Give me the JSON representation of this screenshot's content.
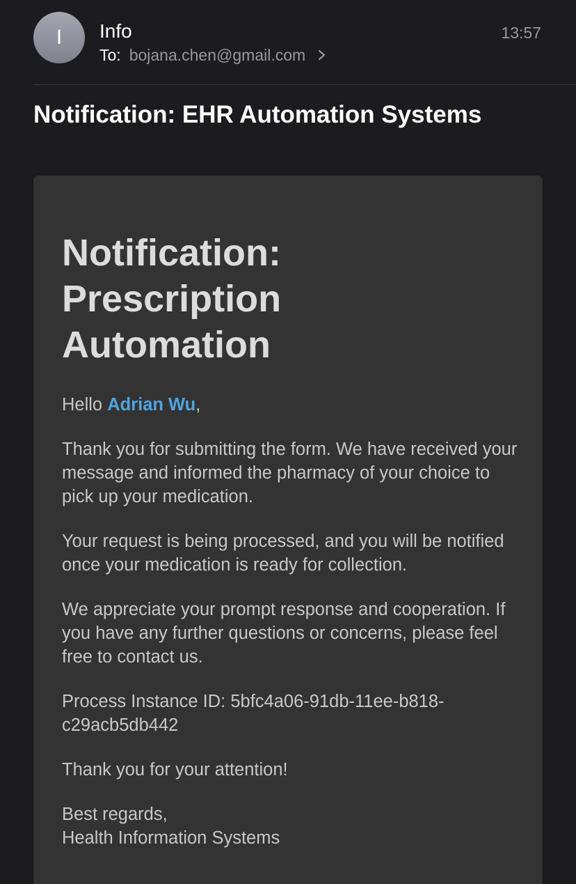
{
  "header": {
    "avatar_initial": "I",
    "sender": "Info",
    "to_label": "To:",
    "to_address": "bojana.chen@gmail.com",
    "time": "13:57"
  },
  "subject": "Notification: EHR Automation Systems",
  "email": {
    "title_line1": "Notification:",
    "title_line2": "Prescription",
    "title_line3": "Automation",
    "greeting_prefix": "Hello ",
    "recipient_name": "Adrian Wu",
    "greeting_suffix": ",",
    "paragraph1": "Thank you for submitting the form. We have received your message and informed the pharmacy of your choice to pick up your medication.",
    "paragraph2": "Your request is being processed, and you will be notified once your medication is ready for collection.",
    "paragraph3": "We appreciate your prompt response and cooperation. If you have any further questions or concerns, please feel free to contact us.",
    "process_line1": "Process Instance ID: 5bfc4a06-91db-11ee-b818-",
    "process_line2": "c29acb5db442",
    "closing": "Thank you for your attention!",
    "signoff": "Best regards,",
    "signature": "Health Information Systems"
  },
  "colors": {
    "background": "#1c1c1e",
    "card": "#333333",
    "link": "#4fa3e0",
    "secondary_text": "#98989f"
  },
  "icons": {
    "chevron": "chevron-right-icon"
  }
}
